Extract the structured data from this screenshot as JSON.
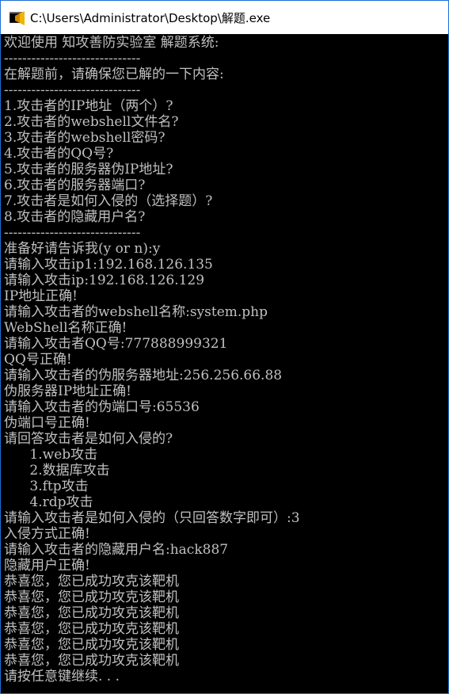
{
  "window": {
    "title": "C:\\Users\\Administrator\\Desktop\\解题.exe",
    "icon": "console-app-icon",
    "accent_color": "#1e6fd9",
    "console_bg": "#000000",
    "console_fg": "#c0c0c0"
  },
  "console": {
    "lines": [
      "欢迎使用 知攻善防实验室 解题系统:",
      "------------------------------",
      "在解题前，请确保您已解的一下内容:",
      "------------------------------",
      "1.攻击者的IP地址（两个）?",
      "2.攻击者的webshell文件名?",
      "3.攻击者的webshell密码?",
      "4.攻击者的QQ号?",
      "5.攻击者的服务器伪IP地址?",
      "6.攻击者的服务器端口?",
      "7.攻击者是如何入侵的（选择题）?",
      "8.攻击者的隐藏用户名?",
      "------------------------------",
      "准备好请告诉我(y or n):y",
      "请输入攻击ip1:192.168.126.135",
      "请输入攻击ip:192.168.126.129",
      "IP地址正确!",
      "请输入攻击者的webshell名称:system.php",
      "WebShell名称正确!",
      "请输入攻击者QQ号:777888999321",
      "QQ号正确!",
      "请输入攻击者的伪服务器地址:256.256.66.88",
      "伪服务器IP地址正确!",
      "请输入攻击者的伪端口号:65536",
      "伪端口号正确!",
      "请回答攻击者是如何入侵的?",
      "      1.web攻击",
      "      2.数据库攻击",
      "      3.ftp攻击",
      "      4.rdp攻击",
      "请输入攻击者是如何入侵的（只回答数字即可）:3",
      "入侵方式正确!",
      "请输入攻击者的隐藏用户名:hack887",
      "隐藏用户正确!",
      "恭喜您，您已成功攻克该靶机",
      "恭喜您，您已成功攻克该靶机",
      "恭喜您，您已成功攻克该靶机",
      "恭喜您，您已成功攻克该靶机",
      "恭喜您，您已成功攻克该靶机",
      "恭喜您，您已成功攻克该靶机",
      "请按任意键继续. . ."
    ]
  }
}
